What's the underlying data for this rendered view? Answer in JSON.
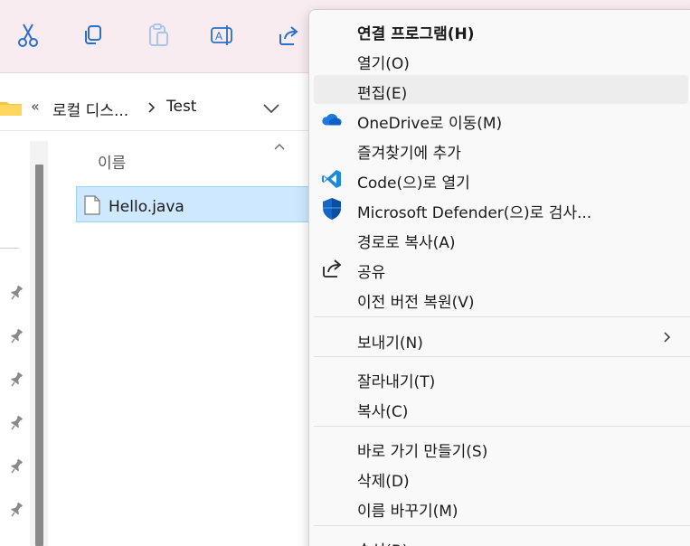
{
  "toolbar": {
    "buttons": [
      {
        "icon": "cut-icon"
      },
      {
        "icon": "copy-icon"
      },
      {
        "icon": "paste-icon"
      },
      {
        "icon": "rename-icon"
      },
      {
        "icon": "share-icon"
      }
    ]
  },
  "address": {
    "overflow": "«",
    "segment1": "로컬 디스...",
    "segment2": "Test"
  },
  "filelist": {
    "column_name": "이름",
    "files": [
      {
        "name": "Hello.java",
        "icon": "file-icon",
        "selected": true
      }
    ]
  },
  "context_menu": {
    "items": [
      {
        "label": "연결 프로그램(H)",
        "bold": true
      },
      {
        "label": "열기(O)"
      },
      {
        "label": "편집(E)",
        "hover": true
      },
      {
        "label": "OneDrive로 이동(M)",
        "icon": "onedrive-icon"
      },
      {
        "label": "즐겨찾기에 추가"
      },
      {
        "label": "Code(으)로 열기",
        "icon": "vscode-icon"
      },
      {
        "label": "Microsoft Defender(으)로 검사...",
        "icon": "defender-icon"
      },
      {
        "label": "경로로 복사(A)"
      },
      {
        "label": "공유",
        "icon": "share-icon"
      },
      {
        "label": "이전 버전 복원(V)"
      },
      {
        "label": "보내기(N)",
        "submenu": true
      },
      {
        "label": "잘라내기(T)"
      },
      {
        "label": "복사(C)"
      },
      {
        "label": "바로 가기 만들기(S)"
      },
      {
        "label": "삭제(D)"
      },
      {
        "label": "이름 바꾸기(M)"
      },
      {
        "label": "속성(R)"
      }
    ]
  },
  "colors": {
    "toolbar_bg": "#f9ecf0",
    "selection_bg": "#cde8ff",
    "accent": "#0067c0"
  }
}
